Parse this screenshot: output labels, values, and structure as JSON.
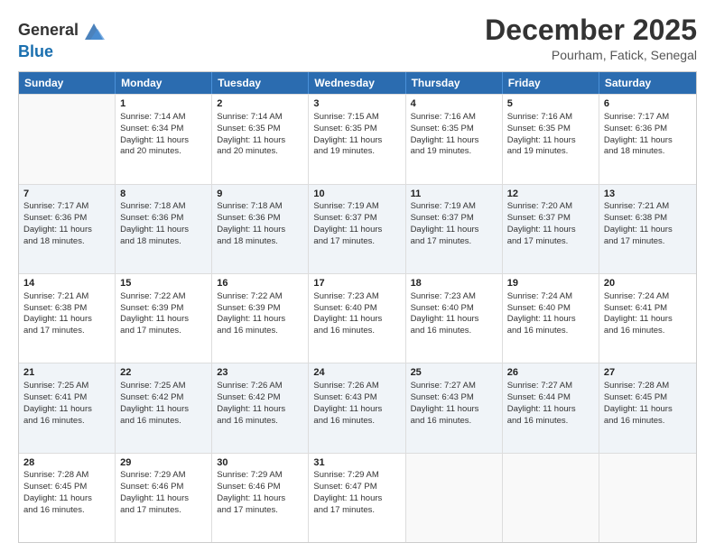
{
  "logo": {
    "line1": "General",
    "line2": "Blue"
  },
  "title": "December 2025",
  "location": "Pourham, Fatick, Senegal",
  "header_days": [
    "Sunday",
    "Monday",
    "Tuesday",
    "Wednesday",
    "Thursday",
    "Friday",
    "Saturday"
  ],
  "weeks": [
    [
      {
        "day": "",
        "info": ""
      },
      {
        "day": "1",
        "info": "Sunrise: 7:14 AM\nSunset: 6:34 PM\nDaylight: 11 hours\nand 20 minutes."
      },
      {
        "day": "2",
        "info": "Sunrise: 7:14 AM\nSunset: 6:35 PM\nDaylight: 11 hours\nand 20 minutes."
      },
      {
        "day": "3",
        "info": "Sunrise: 7:15 AM\nSunset: 6:35 PM\nDaylight: 11 hours\nand 19 minutes."
      },
      {
        "day": "4",
        "info": "Sunrise: 7:16 AM\nSunset: 6:35 PM\nDaylight: 11 hours\nand 19 minutes."
      },
      {
        "day": "5",
        "info": "Sunrise: 7:16 AM\nSunset: 6:35 PM\nDaylight: 11 hours\nand 19 minutes."
      },
      {
        "day": "6",
        "info": "Sunrise: 7:17 AM\nSunset: 6:36 PM\nDaylight: 11 hours\nand 18 minutes."
      }
    ],
    [
      {
        "day": "7",
        "info": "Sunrise: 7:17 AM\nSunset: 6:36 PM\nDaylight: 11 hours\nand 18 minutes."
      },
      {
        "day": "8",
        "info": "Sunrise: 7:18 AM\nSunset: 6:36 PM\nDaylight: 11 hours\nand 18 minutes."
      },
      {
        "day": "9",
        "info": "Sunrise: 7:18 AM\nSunset: 6:36 PM\nDaylight: 11 hours\nand 18 minutes."
      },
      {
        "day": "10",
        "info": "Sunrise: 7:19 AM\nSunset: 6:37 PM\nDaylight: 11 hours\nand 17 minutes."
      },
      {
        "day": "11",
        "info": "Sunrise: 7:19 AM\nSunset: 6:37 PM\nDaylight: 11 hours\nand 17 minutes."
      },
      {
        "day": "12",
        "info": "Sunrise: 7:20 AM\nSunset: 6:37 PM\nDaylight: 11 hours\nand 17 minutes."
      },
      {
        "day": "13",
        "info": "Sunrise: 7:21 AM\nSunset: 6:38 PM\nDaylight: 11 hours\nand 17 minutes."
      }
    ],
    [
      {
        "day": "14",
        "info": "Sunrise: 7:21 AM\nSunset: 6:38 PM\nDaylight: 11 hours\nand 17 minutes."
      },
      {
        "day": "15",
        "info": "Sunrise: 7:22 AM\nSunset: 6:39 PM\nDaylight: 11 hours\nand 17 minutes."
      },
      {
        "day": "16",
        "info": "Sunrise: 7:22 AM\nSunset: 6:39 PM\nDaylight: 11 hours\nand 16 minutes."
      },
      {
        "day": "17",
        "info": "Sunrise: 7:23 AM\nSunset: 6:40 PM\nDaylight: 11 hours\nand 16 minutes."
      },
      {
        "day": "18",
        "info": "Sunrise: 7:23 AM\nSunset: 6:40 PM\nDaylight: 11 hours\nand 16 minutes."
      },
      {
        "day": "19",
        "info": "Sunrise: 7:24 AM\nSunset: 6:40 PM\nDaylight: 11 hours\nand 16 minutes."
      },
      {
        "day": "20",
        "info": "Sunrise: 7:24 AM\nSunset: 6:41 PM\nDaylight: 11 hours\nand 16 minutes."
      }
    ],
    [
      {
        "day": "21",
        "info": "Sunrise: 7:25 AM\nSunset: 6:41 PM\nDaylight: 11 hours\nand 16 minutes."
      },
      {
        "day": "22",
        "info": "Sunrise: 7:25 AM\nSunset: 6:42 PM\nDaylight: 11 hours\nand 16 minutes."
      },
      {
        "day": "23",
        "info": "Sunrise: 7:26 AM\nSunset: 6:42 PM\nDaylight: 11 hours\nand 16 minutes."
      },
      {
        "day": "24",
        "info": "Sunrise: 7:26 AM\nSunset: 6:43 PM\nDaylight: 11 hours\nand 16 minutes."
      },
      {
        "day": "25",
        "info": "Sunrise: 7:27 AM\nSunset: 6:43 PM\nDaylight: 11 hours\nand 16 minutes."
      },
      {
        "day": "26",
        "info": "Sunrise: 7:27 AM\nSunset: 6:44 PM\nDaylight: 11 hours\nand 16 minutes."
      },
      {
        "day": "27",
        "info": "Sunrise: 7:28 AM\nSunset: 6:45 PM\nDaylight: 11 hours\nand 16 minutes."
      }
    ],
    [
      {
        "day": "28",
        "info": "Sunrise: 7:28 AM\nSunset: 6:45 PM\nDaylight: 11 hours\nand 16 minutes."
      },
      {
        "day": "29",
        "info": "Sunrise: 7:29 AM\nSunset: 6:46 PM\nDaylight: 11 hours\nand 17 minutes."
      },
      {
        "day": "30",
        "info": "Sunrise: 7:29 AM\nSunset: 6:46 PM\nDaylight: 11 hours\nand 17 minutes."
      },
      {
        "day": "31",
        "info": "Sunrise: 7:29 AM\nSunset: 6:47 PM\nDaylight: 11 hours\nand 17 minutes."
      },
      {
        "day": "",
        "info": ""
      },
      {
        "day": "",
        "info": ""
      },
      {
        "day": "",
        "info": ""
      }
    ]
  ]
}
